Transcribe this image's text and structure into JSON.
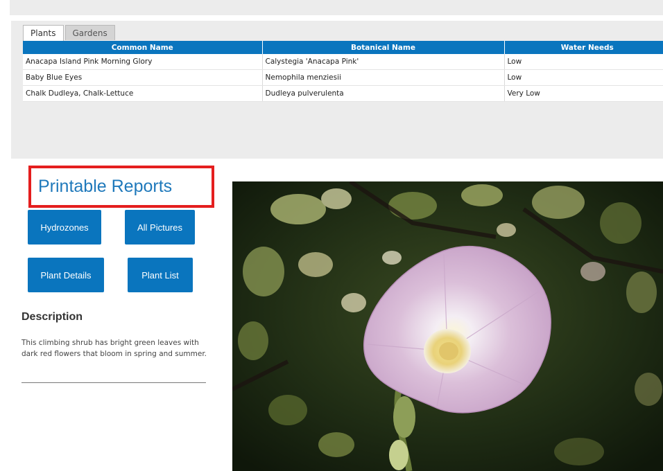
{
  "tabs": [
    {
      "label": "Plants",
      "active": true
    },
    {
      "label": "Gardens",
      "active": false
    }
  ],
  "table": {
    "columns": [
      "Common Name",
      "Botanical Name",
      "Water Needs"
    ],
    "rows": [
      [
        "Anacapa Island Pink Morning Glory",
        "Calystegia 'Anacapa Pink'",
        "Low"
      ],
      [
        "Baby Blue Eyes",
        "Nemophila menziesii",
        "Low"
      ],
      [
        "Chalk Dudleya, Chalk-Lettuce",
        "Dudleya pulverulenta",
        "Very Low"
      ]
    ]
  },
  "reports": {
    "title": "Printable Reports",
    "buttons": {
      "hydrozones": "Hydrozones",
      "all_pictures": "All Pictures",
      "plant_details": "Plant Details",
      "plant_list": "Plant List"
    }
  },
  "description": {
    "heading": "Description",
    "text": "This climbing shrub has bright green leaves with dark red flowers that bloom in spring and summer."
  },
  "colors": {
    "accent_blue": "#0a75be",
    "title_blue": "#1f79bb",
    "highlight_red": "#e41e1e",
    "panel_gray": "#ececec"
  }
}
